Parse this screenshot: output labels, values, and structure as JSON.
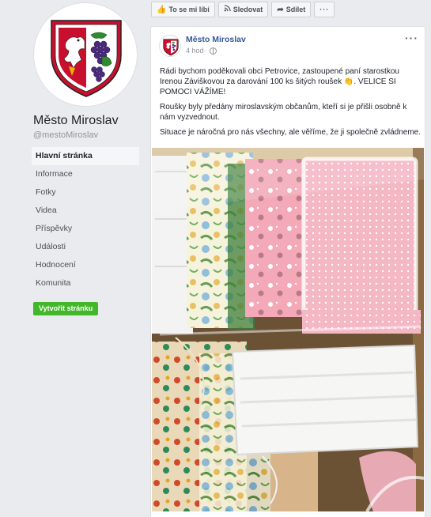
{
  "page": {
    "name": "Město Miroslav",
    "handle": "@mestoMiroslav"
  },
  "nav": {
    "items": [
      {
        "label": "Hlavní stránka"
      },
      {
        "label": "Informace"
      },
      {
        "label": "Fotky"
      },
      {
        "label": "Videa"
      },
      {
        "label": "Příspěvky"
      },
      {
        "label": "Události"
      },
      {
        "label": "Hodnocení"
      },
      {
        "label": "Komunita"
      }
    ],
    "active": "Hlavní stránka",
    "create_button": "Vytvořit stránku"
  },
  "actions": {
    "like": "To se mi líbí",
    "follow": "Sledovat",
    "share": "Sdílet"
  },
  "post": {
    "author": "Město Miroslav",
    "time": "4 hod",
    "paragraph1": "Rádi bychom poděkovali obci Petrovice, zastoupené paní starostkou Irenou Záviškovou za darování 100 ks šitých roušek 👏. VELICE SI POMOCI VÁŽÍME!",
    "paragraph2": "Roušky byly předány miroslavským občanům, kteří si je přišli osobně k nám vyzvednout.",
    "paragraph3": "Situace je náročná pro nás všechny, ale věříme, že ji společně zvládneme."
  },
  "colors": {
    "accent": "#385898",
    "create_button": "#42b72a",
    "background": "#e9ebee"
  }
}
